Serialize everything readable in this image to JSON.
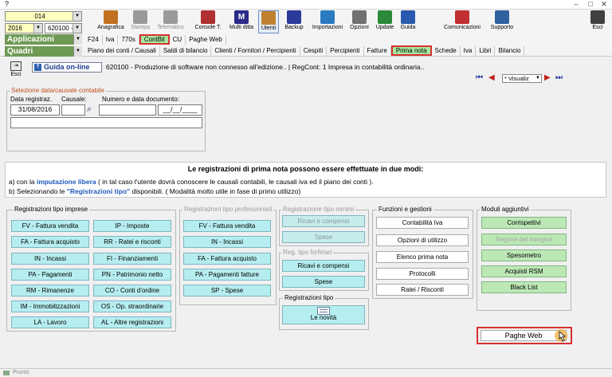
{
  "window": {
    "title": "?",
    "controls": {
      "minimize": "–",
      "maximize": "□",
      "close": "✕"
    }
  },
  "header": {
    "code_value": "014",
    "year_value": "2016",
    "company_value": "620100 -",
    "apps_label": "Applicazioni",
    "quadri_label": "Quadri",
    "toolbar": [
      {
        "label": "Anagrafica",
        "icon": "address-book-icon",
        "color": "#c07020"
      },
      {
        "label": "Stampa",
        "icon": "printer-icon",
        "color": "#9a9a9a"
      },
      {
        "label": "Telematico",
        "icon": "network-icon",
        "color": "#9a9a9a"
      },
      {
        "label": "Console T.",
        "icon": "console-icon",
        "color": "#b03030"
      },
      {
        "label": "Multi ditta",
        "icon": "multi-company-icon",
        "color": "#2a2a8a"
      },
      {
        "label": "Utenti",
        "icon": "users-icon",
        "color": "#c08030"
      },
      {
        "label": "Backup",
        "icon": "backup-icon",
        "color": "#2a3a9a"
      },
      {
        "label": "Importazioni",
        "icon": "import-icon",
        "color": "#2a7ac0"
      },
      {
        "label": "Opzioni",
        "icon": "options-icon",
        "color": "#707070"
      },
      {
        "label": "Update",
        "icon": "update-icon",
        "color": "#2a8a3a"
      },
      {
        "label": "Guida",
        "icon": "help-icon",
        "color": "#2a5ab0"
      },
      {
        "label": "Comunicazioni",
        "icon": "communications-icon",
        "color": "#c03030"
      },
      {
        "label": "Supporto",
        "icon": "support-icon",
        "color": "#3060a0"
      },
      {
        "label": "Esci",
        "icon": "exit-icon",
        "color": "#404040"
      }
    ],
    "apps_menu": [
      "F24",
      "Iva",
      "770s",
      "ContBil",
      "CU",
      "Paghe Web"
    ],
    "quadri_menu": [
      "Piano dei conti / Causali",
      "Saldi di bilancio",
      "Clienti / Fornitori / Percipienti",
      "Cespiti",
      "Percipienti",
      "Fatture",
      "Prima nota",
      "Schede",
      "Iva",
      "Libri",
      "Bilancio"
    ]
  },
  "nav": {
    "esci_label": "Esci",
    "guida_label": "Guida on-line",
    "company_text": "620100 - Produzione di software non connesso all'edizione.. | RegCont: 1 Impresa  in contabilità ordinaria..",
    "view_value": "* Visualiz",
    "arrows": {
      "first": "⏮",
      "prev": "◀",
      "next": "▶",
      "last": "⏭"
    }
  },
  "selection": {
    "title": "Selezione data/causale contabile",
    "date_label": "Data registraz.",
    "causale_label": "Causale:",
    "doc_label": "Numero e data documento:",
    "date_value": "31/08/2016",
    "doc_date_value": "__/__/____"
  },
  "info": {
    "title": "Le registrazioni di prima nota possono essere effettuate in due modi:",
    "line_a_pre": "a) con la",
    "line_a_bold": "imputazione libera",
    "line_a_post": "( in tal caso l'utente dovrà conoscere le causali contabili, le causali iva ed il piano dei conti ).",
    "line_b_pre": "b) Selezionando le",
    "line_b_bold": "\"Registrazioni tipo\"",
    "line_b_post": "disponibili. ( Modalità molto utile in fase di primo utilizzo)"
  },
  "groups": {
    "imprese": {
      "title": "Registrazioni tipo imprese",
      "left": [
        "FV - Fattura vendita",
        "FA - Fattura acquisto",
        "IN - Incassi",
        "PA - Pagamenti",
        "RM - Rimanenze",
        "IM - Immobilizzazioni",
        "LA - Lavoro"
      ],
      "right": [
        "IP - Imposte",
        "RR - Ratei e risconti",
        "FI - Finanziamenti",
        "PN - Patrimonio netto",
        "CO - Conti d'ordine",
        "OS - Op. straordinarie",
        "AL - Altre registrazioni"
      ]
    },
    "professionisti": {
      "title": "Registrazioni tipo professionisti",
      "items": [
        "FV - Fattura vendita",
        "IN - Incassi",
        "FA - Fattura acquisto",
        "PA - Pagamenti fatture",
        "SP - Spese"
      ]
    },
    "minimi": {
      "title": "Registrazione tipo minimi",
      "items": [
        "Ricavi e compensi",
        "Spese"
      ]
    },
    "forfetari": {
      "title": "Reg. tipo forfetari",
      "items": [
        "Ricavi e compensi",
        "Spese"
      ]
    },
    "tipo": {
      "title": "Registrazioni tipo",
      "button": "Le novità"
    },
    "funzioni": {
      "title": "Funzioni e gestioni",
      "items": [
        "Contabilità Iva",
        "Opzioni di utilizzo",
        "Elenco prima nota",
        "Protocolli",
        "Ratei / Risconti"
      ]
    },
    "moduli": {
      "title": "Moduli aggiuntivi",
      "items": [
        "Corrispettivi",
        "Regime del margine",
        "Spesometro",
        "Acquisti RSM",
        "Black List"
      ]
    }
  },
  "paghe_web_button": "Paghe Web",
  "status": "Pronto"
}
